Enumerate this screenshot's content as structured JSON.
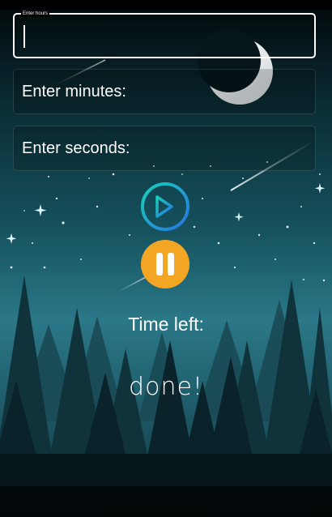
{
  "hours": {
    "label": "Enter hours",
    "value": ""
  },
  "minutes": {
    "placeholder": "Enter minutes:"
  },
  "seconds": {
    "placeholder": "Enter seconds:"
  },
  "controls": {
    "skip_icon": "skip-next-icon",
    "pause_icon": "pause-icon"
  },
  "timer": {
    "label": "Time left:",
    "status": "done!"
  },
  "colors": {
    "accent_teal": "#16c7c0",
    "accent_blue": "#2e7fe0",
    "pause_orange": "#f5a623"
  }
}
